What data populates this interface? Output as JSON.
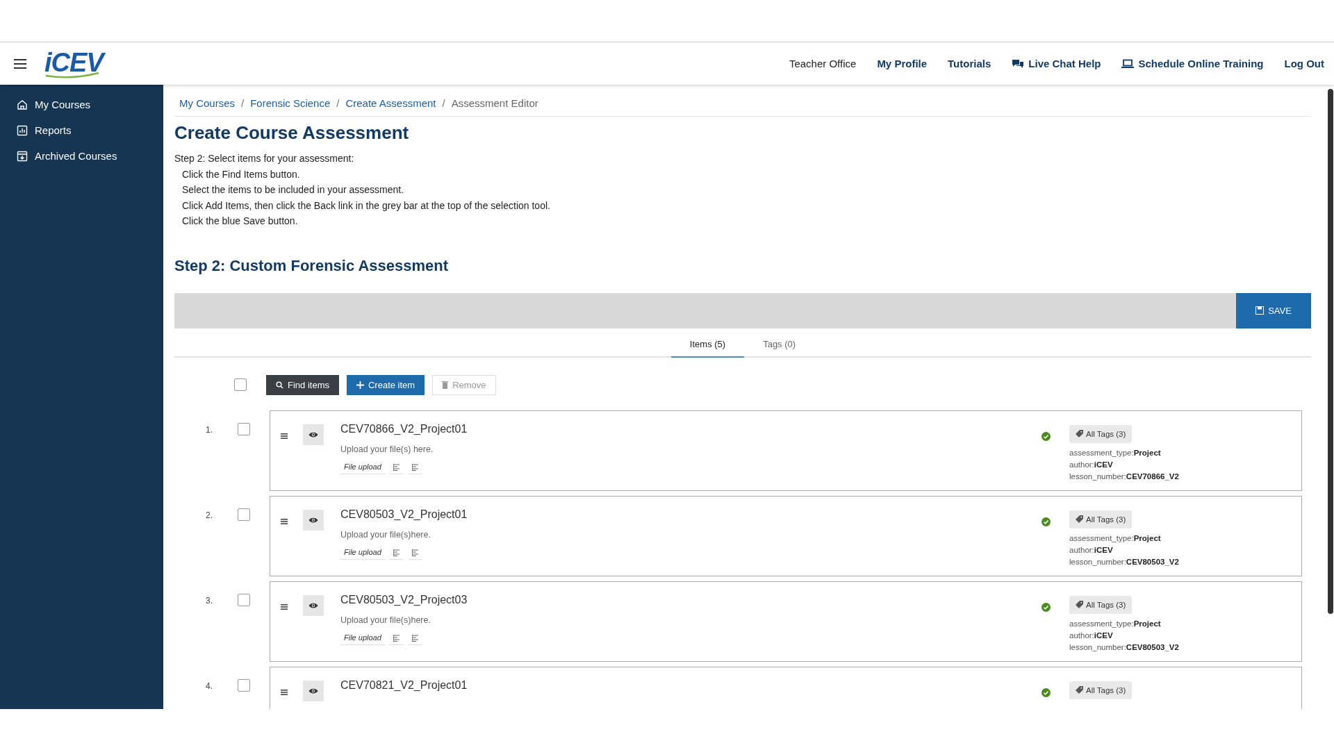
{
  "header": {
    "logo": "iCEV",
    "nav": [
      {
        "label": "Teacher Office",
        "kind": "plain"
      },
      {
        "label": "My Profile",
        "kind": "bold"
      },
      {
        "label": "Tutorials",
        "kind": "bold"
      },
      {
        "label": "Live Chat Help",
        "kind": "chat"
      },
      {
        "label": "Schedule Online Training",
        "kind": "laptop"
      },
      {
        "label": "Log Out",
        "kind": "bold"
      }
    ]
  },
  "sidebar": {
    "items": [
      {
        "label": "My Courses",
        "kind": "home"
      },
      {
        "label": "Reports",
        "kind": "chart"
      },
      {
        "label": "Archived Courses",
        "kind": "archive"
      }
    ]
  },
  "breadcrumbs": [
    {
      "label": "My Courses",
      "kind": "link"
    },
    {
      "label": "/",
      "kind": "separator"
    },
    {
      "label": "Forensic Science",
      "kind": "link"
    },
    {
      "label": "/",
      "kind": "separator"
    },
    {
      "label": "Create Assessment",
      "kind": "link"
    },
    {
      "label": "/",
      "kind": "separator"
    },
    {
      "label": "Assessment Editor",
      "kind": "current"
    }
  ],
  "title": "Create Course Assessment",
  "instructions": {
    "lead": "Step 2: Select items for your assessment:",
    "steps": [
      "Click the Find Items button.",
      "Select the items to be included in your assessment.",
      "Click Add Items, then click the Back link in the grey bar at the top of the selection tool.",
      "Click the blue Save button."
    ]
  },
  "section_title": "Step 2: Custom Forensic Assessment",
  "save_label": "SAVE",
  "tabs": [
    {
      "label": "Items (5)",
      "selected": true
    },
    {
      "label": "Tags (0)",
      "selected": false
    }
  ],
  "toolbar": {
    "select_all_checked": false,
    "buttons": [
      {
        "label": "Find items",
        "kind": "find",
        "disabled": false
      },
      {
        "label": "Create item",
        "kind": "create",
        "disabled": false
      },
      {
        "label": "Remove",
        "kind": "remove",
        "disabled": true
      }
    ]
  },
  "items": [
    {
      "number": "1.",
      "checked": false,
      "title": "CEV70866_V2_Project01",
      "description": "Upload your file(s) here.",
      "type_label": "File upload",
      "verified": true,
      "tags_label": "All Tags (3)",
      "tags": [
        {
          "key": "assessment_type:",
          "value": "Project"
        },
        {
          "key": "author:",
          "value": "iCEV"
        },
        {
          "key": "lesson_number:",
          "value": "CEV70866_V2"
        }
      ]
    },
    {
      "number": "2.",
      "checked": false,
      "title": "CEV80503_V2_Project01",
      "description": "Upload your file(s)here.",
      "type_label": "File upload",
      "verified": true,
      "tags_label": "All Tags (3)",
      "tags": [
        {
          "key": "assessment_type:",
          "value": "Project"
        },
        {
          "key": "author:",
          "value": "iCEV"
        },
        {
          "key": "lesson_number:",
          "value": "CEV80503_V2"
        }
      ]
    },
    {
      "number": "3.",
      "checked": false,
      "title": "CEV80503_V2_Project03",
      "description": "Upload your file(s)here.",
      "type_label": "File upload",
      "verified": true,
      "tags_label": "All Tags (3)",
      "tags": [
        {
          "key": "assessment_type:",
          "value": "Project"
        },
        {
          "key": "author:",
          "value": "iCEV"
        },
        {
          "key": "lesson_number:",
          "value": "CEV80503_V2"
        }
      ]
    },
    {
      "number": "4.",
      "checked": false,
      "title": "CEV70821_V2_Project01",
      "verified": true,
      "tags_label": "All Tags (3)"
    }
  ]
}
